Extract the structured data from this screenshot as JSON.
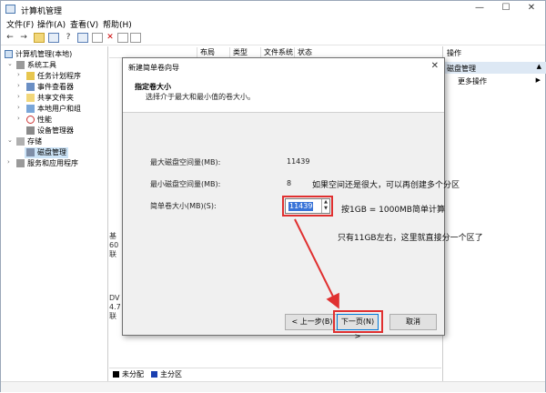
{
  "window": {
    "title": "计算机管理"
  },
  "menu": {
    "file": "文件(F)",
    "action": "操作(A)",
    "view": "查看(V)",
    "help": "帮助(H)"
  },
  "tree": {
    "root": "计算机管理(本地)",
    "system_tools": "系统工具",
    "task_scheduler": "任务计划程序",
    "event_viewer": "事件查看器",
    "shared_folders": "共享文件夹",
    "local_users": "本地用户和组",
    "performance": "性能",
    "device_manager": "设备管理器",
    "storage": "存储",
    "disk_management": "磁盘管理",
    "services_apps": "服务和应用程序"
  },
  "columns": {
    "layout": "布局",
    "type": "类型",
    "filesystem": "文件系统",
    "status": "状态"
  },
  "actions": {
    "header": "操作",
    "selected": "磁盘管理",
    "more": "更多操作"
  },
  "disk_strip": {
    "top_lines": [
      "基",
      "60",
      "联"
    ],
    "bottom_lines": [
      "DV",
      "4.7",
      "联"
    ]
  },
  "legend": {
    "unallocated": "未分配",
    "primary": "主分区"
  },
  "dialog": {
    "title": "新建简单卷向导",
    "heading": "指定卷大小",
    "subheading": "选择介于最大和最小值的卷大小。",
    "max_label": "最大磁盘空间量(MB):",
    "max_value": "11439",
    "min_label": "最小磁盘空间量(MB):",
    "min_value": "8",
    "size_label": "简单卷大小(MB)(S):",
    "size_value": "11439",
    "back": "< 上一步(B)",
    "next": "下一页(N) >",
    "cancel": "取消"
  },
  "annotations": {
    "note1": "如果空间还是很大，可以再创建多个分区",
    "note2": "按1GB = 1000MB简单计算",
    "note3": "只有11GB左右，这里就直接分一个区了"
  },
  "colors": {
    "annotation_red": "#e03030",
    "selection_blue": "#3a74d8"
  }
}
